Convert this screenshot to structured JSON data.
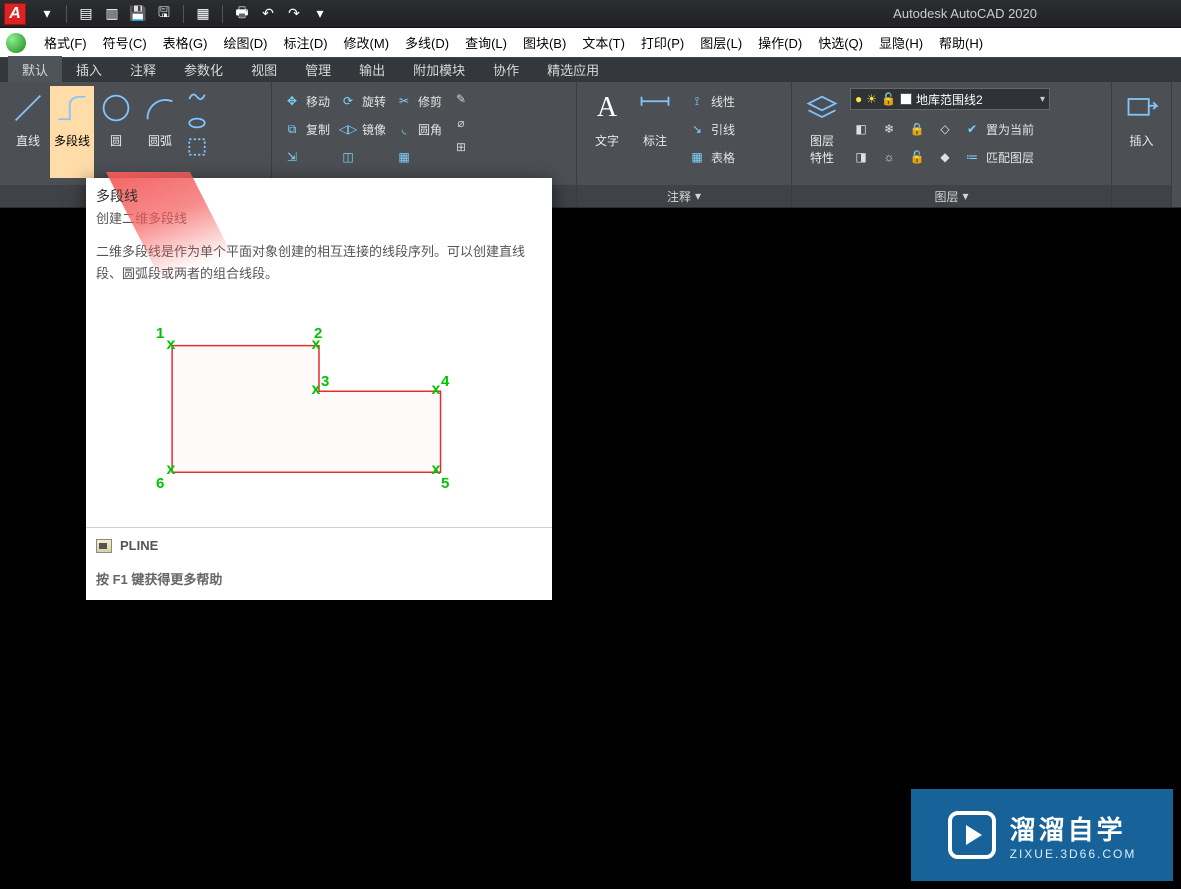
{
  "app_title": "Autodesk AutoCAD 2020",
  "menu": [
    "格式(F)",
    "符号(C)",
    "表格(G)",
    "绘图(D)",
    "标注(D)",
    "修改(M)",
    "多线(D)",
    "查询(L)",
    "图块(B)",
    "文本(T)",
    "打印(P)",
    "图层(L)",
    "操作(D)",
    "快选(Q)",
    "显隐(H)",
    "帮助(H)"
  ],
  "tabs": [
    "默认",
    "插入",
    "注释",
    "参数化",
    "视图",
    "管理",
    "输出",
    "附加模块",
    "协作",
    "精选应用"
  ],
  "active_tab": "默认",
  "draw_panel": {
    "line": "直线",
    "polyline": "多段线",
    "circle": "圆",
    "arc": "圆弧"
  },
  "modify_panel": {
    "move": "移动",
    "rotate": "旋转",
    "trim": "修剪",
    "copy": "复制",
    "mirror": "镜像",
    "fillet": "圆角"
  },
  "annotation_panel": {
    "text": "文字",
    "dim": "标注",
    "linetype": "线性",
    "leader": "引线",
    "table": "表格",
    "title": "注释"
  },
  "layers_panel": {
    "props": "图层\n特性",
    "dropdown": "地库范围线2",
    "set_current": "置为当前",
    "match": "匹配图层",
    "title": "图层"
  },
  "insert_panel": {
    "label": "插入"
  },
  "tooltip": {
    "title": "多段线",
    "subtitle": "创建二维多段线",
    "body": "二维多段线是作为单个平面对象创建的相互连接的线段序列。可以创建直线段、圆弧段或两者的组合线段。",
    "command": "PLINE",
    "help": "按 F1 键获得更多帮助",
    "points": [
      "1",
      "2",
      "3",
      "4",
      "5",
      "6"
    ]
  },
  "zixue": {
    "big": "溜溜自学",
    "small": "ZIXUE.3D66.COM"
  }
}
